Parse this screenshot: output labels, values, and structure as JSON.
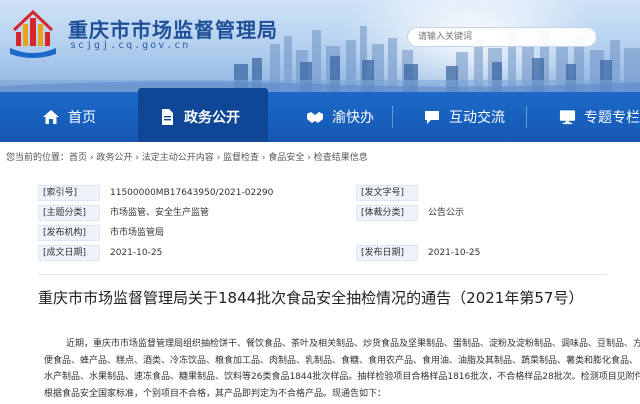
{
  "header": {
    "site_title": "重庆市市场监督管理局",
    "site_domain": "scjgj.cq.gov.cn",
    "search_placeholder": "请输入关键词"
  },
  "nav": {
    "items": [
      {
        "label": "首页",
        "icon": "home-icon"
      },
      {
        "label": "政务公开",
        "icon": "document-icon",
        "active": true
      },
      {
        "label": "渝快办",
        "icon": "handshake-icon"
      },
      {
        "label": "互动交流",
        "icon": "chat-icon"
      },
      {
        "label": "专题专栏",
        "icon": "monitor-icon"
      }
    ]
  },
  "breadcrumb": {
    "prefix": "您当前的位置：",
    "items": [
      "首页",
      "政务公开",
      "法定主动公开内容",
      "监督检查",
      "食品安全",
      "检查结果信息"
    ],
    "separator": " › "
  },
  "meta": {
    "index_no_label": "[索引号]",
    "index_no": "11500000MB17643950/2021-02290",
    "doc_no_label": "[发文字号]",
    "doc_no": "",
    "category_label": "[主题分类]",
    "category": "市场监管、安全生产监管",
    "genre_label": "[体裁分类]",
    "genre": "公告公示",
    "issuer_label": "[发布机构]",
    "issuer": "市市场监管局",
    "created_label": "[成文日期]",
    "created": "2021-10-25",
    "published_label": "[发布日期]",
    "published": "2021-10-25"
  },
  "article": {
    "title": "重庆市市场监督管理局关于1844批次食品安全抽检情况的通告（2021年第57号）",
    "lines": [
      "近期，重庆市市场监督管理局组织抽检饼干、餐饮食品、茶叶及相关制品、炒货食品及坚果制品、蛋制品、淀粉及淀粉制品、调味品、豆制品、方",
      "便食品、蜂产品、糕点、酒类、冷冻饮品、粮食加工品、肉制品、乳制品、食糖、食用农产品、食用油、油脂及其制品、蔬菜制品、薯类和膨化食品、",
      "水产制品、水果制品、速冻食品、糖果制品、饮料等26类食品1844批次样品。抽样检验项目合格样品1816批次，不合格样品28批次。检测项目见附件。",
      "根据食品安全国家标准，个别项目不合格，其产品即判定为不合格产品。现通告如下："
    ]
  },
  "colors": {
    "nav_bg": "#1c69c9",
    "nav_active": "#0f4796",
    "title_blue": "#1f4f96"
  }
}
